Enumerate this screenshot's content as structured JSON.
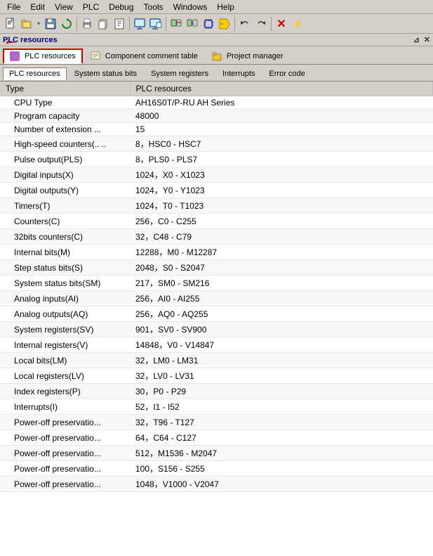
{
  "menubar": {
    "items": [
      "File",
      "Edit",
      "View",
      "PLC",
      "Debug",
      "Tools",
      "Windows",
      "Help"
    ]
  },
  "toolbar": {
    "buttons": [
      {
        "name": "new",
        "icon": "📄"
      },
      {
        "name": "open",
        "icon": "📂"
      },
      {
        "name": "dropdown1",
        "icon": "▾"
      },
      {
        "name": "save",
        "icon": "💾"
      },
      {
        "name": "refresh",
        "icon": "🔄"
      },
      {
        "name": "sep1",
        "type": "sep"
      },
      {
        "name": "print",
        "icon": "🖨"
      },
      {
        "name": "copy",
        "icon": "📋"
      },
      {
        "name": "paste",
        "icon": "📌"
      },
      {
        "name": "sep2",
        "type": "sep"
      },
      {
        "name": "zoom",
        "icon": "🔍"
      },
      {
        "name": "settings",
        "icon": "⚙"
      },
      {
        "name": "sep3",
        "type": "sep"
      },
      {
        "name": "run",
        "icon": "▶"
      },
      {
        "name": "stop",
        "icon": "⏹"
      },
      {
        "name": "sep4",
        "type": "sep"
      },
      {
        "name": "undo",
        "icon": "↩"
      },
      {
        "name": "redo",
        "icon": "↪"
      },
      {
        "name": "sep5",
        "type": "sep"
      },
      {
        "name": "close-x",
        "icon": "✕"
      },
      {
        "name": "minimize",
        "icon": "⚡"
      }
    ]
  },
  "panel": {
    "title": "PLC resources",
    "pin_label": "⊿",
    "close_label": "✕"
  },
  "tabs_top": [
    {
      "id": "plc",
      "label": "PLC resources",
      "active": true
    },
    {
      "id": "comp",
      "label": "Component comment table",
      "active": false
    },
    {
      "id": "proj",
      "label": "Project manager",
      "active": false
    }
  ],
  "tabs_sub": [
    {
      "id": "plcres",
      "label": "PLC resources",
      "active": true
    },
    {
      "id": "sysstat",
      "label": "System status bits",
      "active": false
    },
    {
      "id": "sysreg",
      "label": "System registers",
      "active": false
    },
    {
      "id": "intr",
      "label": "Interrupts",
      "active": false
    },
    {
      "id": "errcode",
      "label": "Error code",
      "active": false
    }
  ],
  "table": {
    "headers": [
      "Type",
      "PLC resources"
    ],
    "rows": [
      {
        "type": "CPU Type",
        "value": "AH16S0T/P-RU  AH Series"
      },
      {
        "type": "Program capacity",
        "value": "48000"
      },
      {
        "type": "Number of extension ...",
        "value": "15"
      },
      {
        "type": "High-speed counters(..  ..",
        "value": "8，HSC0 - HSC7"
      },
      {
        "type": "Pulse output(PLS)",
        "value": "8，PLS0 - PLS7"
      },
      {
        "type": "Digital inputs(X)",
        "value": "1024，X0 - X1023"
      },
      {
        "type": "Digital outputs(Y)",
        "value": "1024，Y0 - Y1023"
      },
      {
        "type": "Timers(T)",
        "value": "1024，T0 - T1023"
      },
      {
        "type": "Counters(C)",
        "value": "256，C0 - C255"
      },
      {
        "type": "32bits counters(C)",
        "value": "32，C48 - C79"
      },
      {
        "type": "Internal bits(M)",
        "value": "12288，M0 - M12287"
      },
      {
        "type": "Step status bits(S)",
        "value": "2048，S0 - S2047"
      },
      {
        "type": "System status bits(SM)",
        "value": "217，SM0 - SM216"
      },
      {
        "type": "Analog inputs(AI)",
        "value": "256，AI0 - AI255"
      },
      {
        "type": "Analog outputs(AQ)",
        "value": "256，AQ0 - AQ255"
      },
      {
        "type": "System registers(SV)",
        "value": "901，SV0 - SV900"
      },
      {
        "type": "Internal registers(V)",
        "value": "14848，V0 - V14847"
      },
      {
        "type": "Local bits(LM)",
        "value": "32，LM0 - LM31"
      },
      {
        "type": "Local registers(LV)",
        "value": "32，LV0 - LV31"
      },
      {
        "type": "Index registers(P)",
        "value": "30，P0 - P29"
      },
      {
        "type": "Interrupts(I)",
        "value": "52，I1 - I52"
      },
      {
        "type": "Power-off preservatio...",
        "value": "32，T96 - T127"
      },
      {
        "type": "Power-off preservatio...",
        "value": "64，C64 - C127"
      },
      {
        "type": "Power-off preservatio...",
        "value": "512，M1536 - M2047"
      },
      {
        "type": "Power-off preservatio...",
        "value": "100，S156 - S255"
      },
      {
        "type": "Power-off preservatio...",
        "value": "1048，V1000 - V2047"
      }
    ]
  }
}
